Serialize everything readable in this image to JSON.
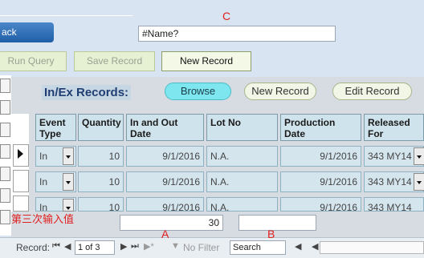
{
  "header": {
    "back_label": "ack",
    "name_field_value": "#Name?",
    "label_c": "C"
  },
  "query_buttons": {
    "run_query": "Run Query",
    "save_record": "Save Record",
    "new_record": "New Record"
  },
  "panel": {
    "title": "In/Ex Records:",
    "browse": "Browse",
    "new_record": "New Record",
    "edit_record": "Edit Record"
  },
  "table": {
    "headers": {
      "event_type": "Event Type",
      "quantity": "Quantity",
      "in_out_date": "In and Out Date",
      "lot_no": "Lot No",
      "production_date": "Production Date",
      "released": "Released For Program"
    },
    "rows": [
      {
        "event_type": "In",
        "quantity": "10",
        "date": "9/1/2016",
        "lot_no": "N.A.",
        "production_date": "9/1/2016",
        "program": "343 MY14"
      },
      {
        "event_type": "In",
        "quantity": "10",
        "date": "9/1/2016",
        "lot_no": "N.A.",
        "production_date": "9/1/2016",
        "program": "343 MY14"
      },
      {
        "event_type": "In",
        "quantity": "10",
        "date": "9/1/2016",
        "lot_no": "N.A.",
        "production_date": "9/1/2016",
        "program": "343 MY14"
      }
    ]
  },
  "footer": {
    "annotation_text": "第三次输入值",
    "total_value": "30",
    "label_a": "A",
    "label_b": "B"
  },
  "navigation": {
    "record_label": "Record:",
    "position": "1 of 3",
    "no_filter": "No Filter",
    "search_placeholder": "Search"
  },
  "colors": {
    "background": "#d8e4f1",
    "accent_blue": "#1f5fa8",
    "annotation_red": "#e02020",
    "browse_pill": "#7ee6ee"
  }
}
